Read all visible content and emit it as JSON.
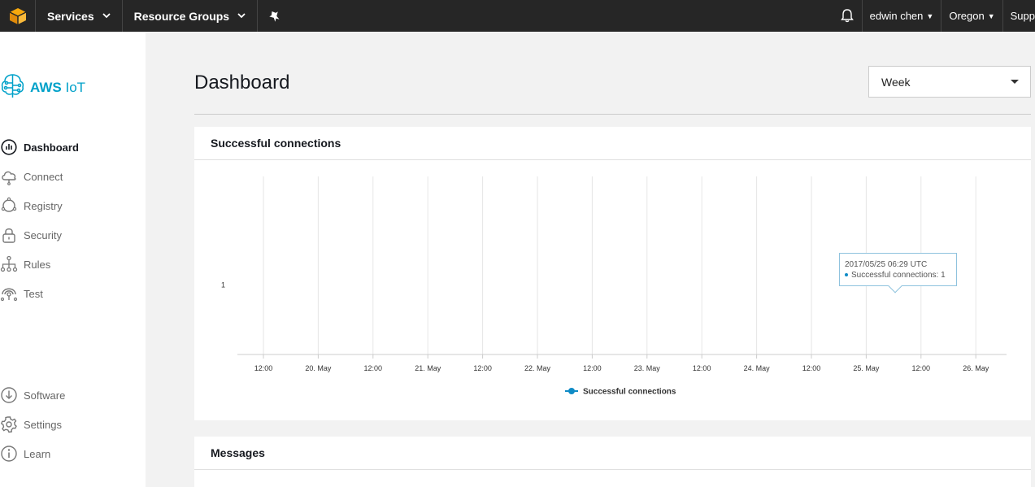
{
  "topnav": {
    "services_label": "Services",
    "resource_groups_label": "Resource Groups",
    "user_label": "edwin chen",
    "region_label": "Oregon",
    "support_label": "Supp"
  },
  "sidebar": {
    "brand_aws": "AWS",
    "brand_iot": "IoT",
    "items": [
      {
        "label": "Dashboard",
        "icon": "dashboard-icon"
      },
      {
        "label": "Connect",
        "icon": "cloud-icon"
      },
      {
        "label": "Registry",
        "icon": "registry-icon"
      },
      {
        "label": "Security",
        "icon": "lock-icon"
      },
      {
        "label": "Rules",
        "icon": "rules-icon"
      },
      {
        "label": "Test",
        "icon": "test-icon"
      }
    ],
    "bottom_items": [
      {
        "label": "Software",
        "icon": "download-icon"
      },
      {
        "label": "Settings",
        "icon": "gear-icon"
      },
      {
        "label": "Learn",
        "icon": "info-icon"
      }
    ]
  },
  "main": {
    "title": "Dashboard",
    "period_select": "Week",
    "connections_card_title": "Successful connections",
    "messages_card_title": "Messages",
    "tooltip": {
      "time": "2017/05/25 06:29 UTC",
      "series_label": "Successful connections:",
      "value": "1"
    }
  },
  "colors": {
    "accent": "#00a1c9",
    "series": "#0f8bc6",
    "topbar": "#262626"
  },
  "chart_data": {
    "type": "line",
    "x_ticks": [
      "12:00",
      "20. May",
      "12:00",
      "21. May",
      "12:00",
      "22. May",
      "12:00",
      "23. May",
      "12:00",
      "24. May",
      "12:00",
      "25. May",
      "12:00",
      "26. May"
    ],
    "y_ticks": [
      "1"
    ],
    "series": [
      {
        "name": "Successful connections",
        "x": [
          "2017/05/25 06:29"
        ],
        "values": [
          1
        ]
      }
    ],
    "legend": "bottom-center",
    "grid": true
  }
}
